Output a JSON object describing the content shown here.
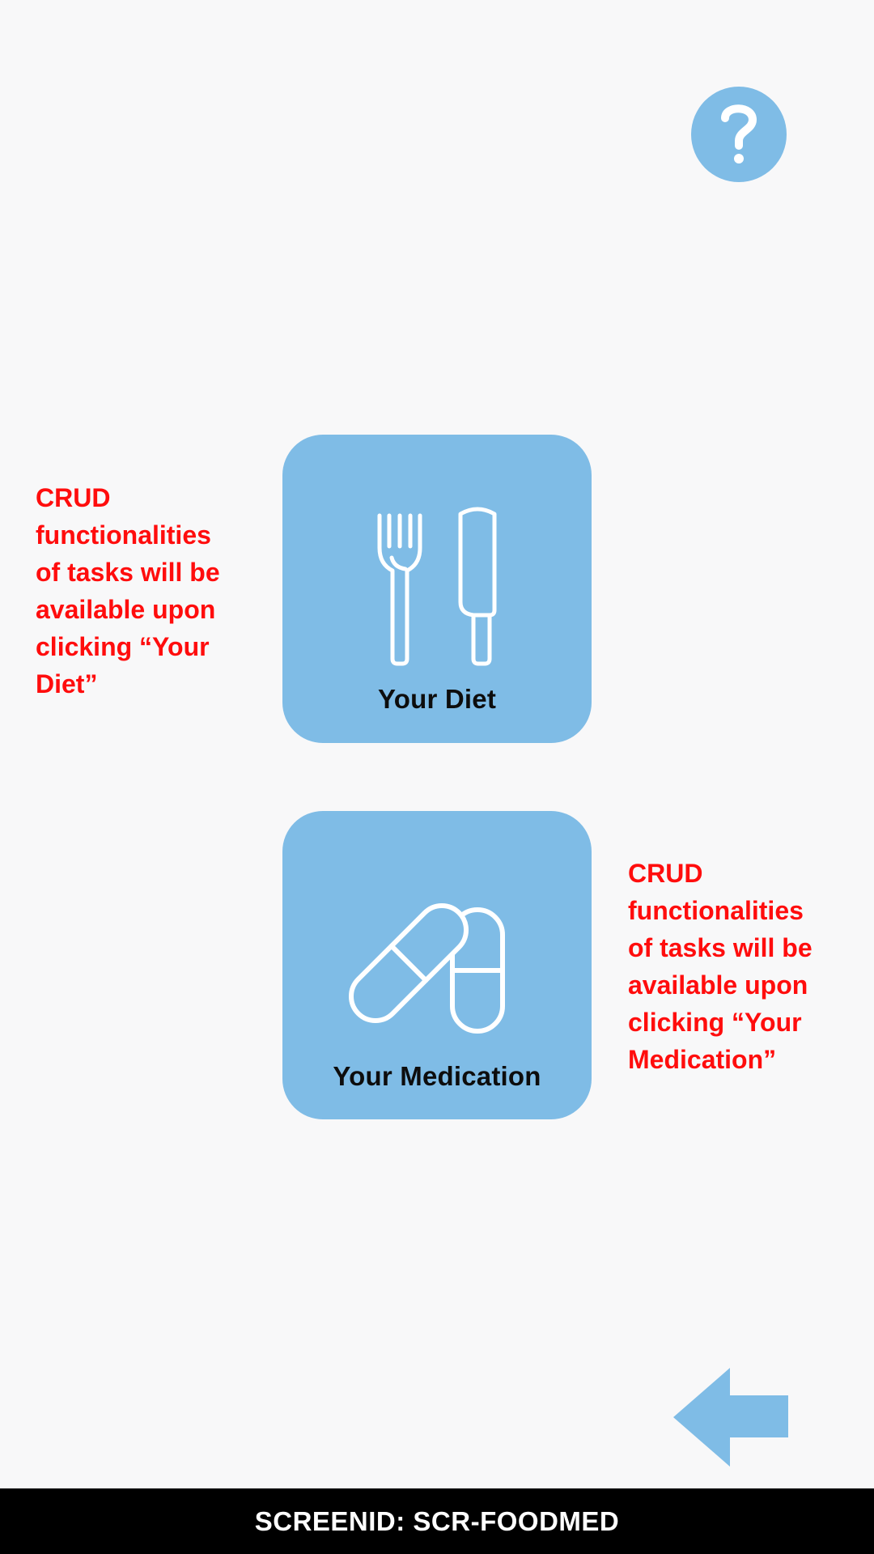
{
  "help": {
    "icon": "question-mark-icon",
    "color": "#7fbce6"
  },
  "tiles": [
    {
      "label": "Your Diet",
      "icon": "fork-knife-icon"
    },
    {
      "label": "Your Medication",
      "icon": "pills-icon"
    }
  ],
  "notes": {
    "diet": "CRUD\nfunctionalities\nof tasks will be\navailable upon\nclicking “Your\nDiet”",
    "medication": "CRUD\nfunctionalities\nof tasks will be\navailable upon\nclicking “Your\nMedication”"
  },
  "back": {
    "icon": "back-arrow-icon"
  },
  "footer": {
    "screen_id": "SCREENID: SCR-FOODMED"
  },
  "colors": {
    "accent": "#7fbce6",
    "annotation": "#ff0d0d",
    "background": "#f8f8f9",
    "footer_bg": "#000000"
  }
}
